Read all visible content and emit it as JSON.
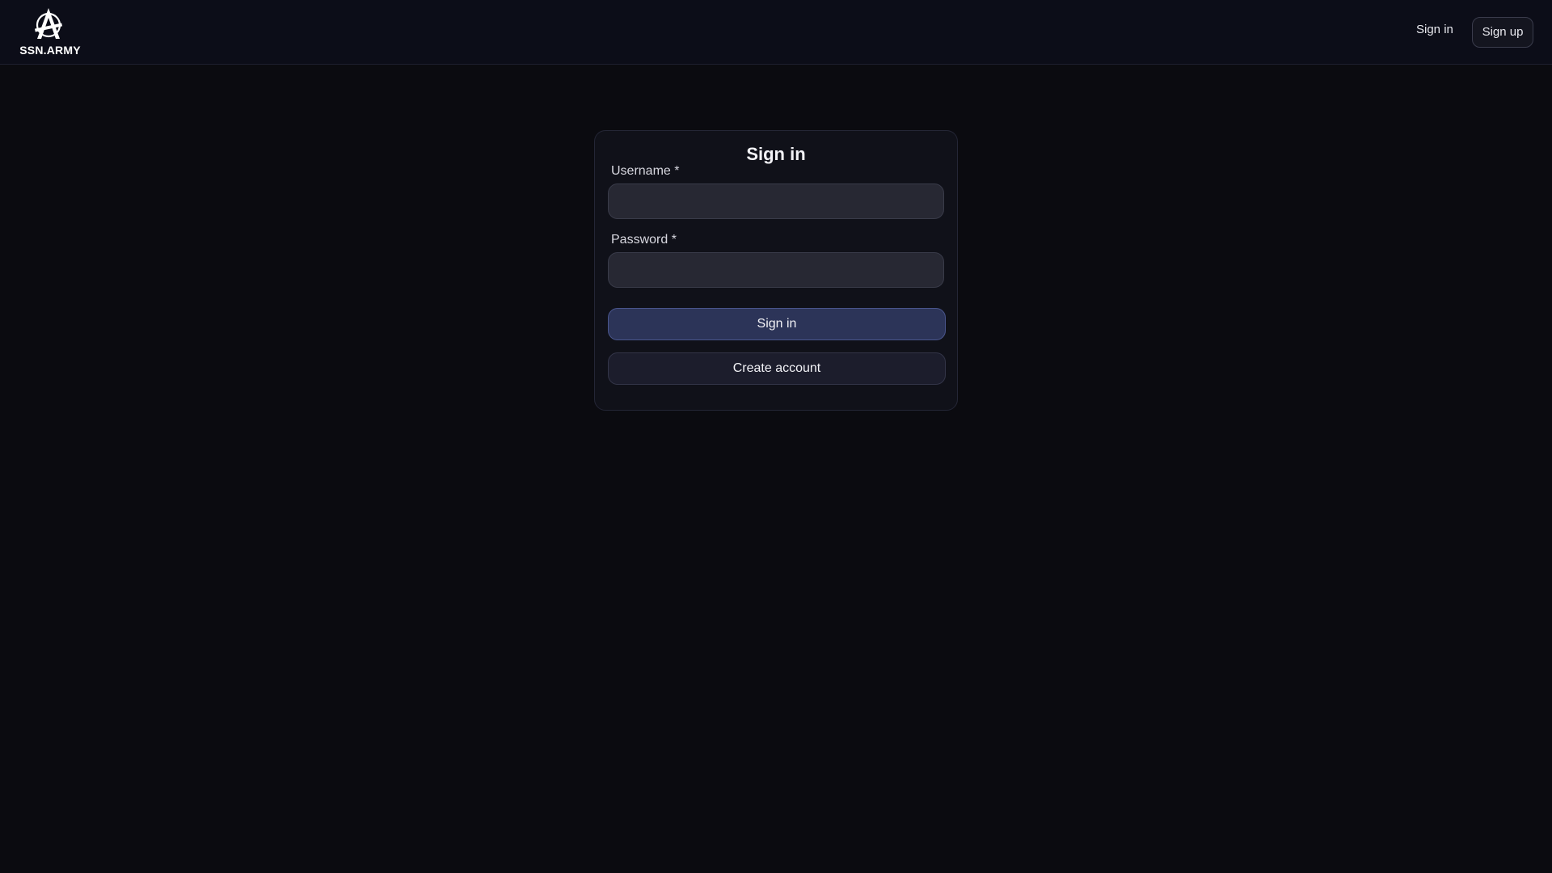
{
  "header": {
    "brand_name": "SSN.ARMY",
    "logo_icon": "anarchy-a-logo-icon",
    "nav": {
      "signin_label": "Sign in",
      "signup_label": "Sign up"
    }
  },
  "login_form": {
    "title": "Sign in",
    "username": {
      "label": "Username *",
      "value": "",
      "placeholder": ""
    },
    "password": {
      "label": "Password *",
      "value": "",
      "placeholder": ""
    },
    "submit_label": "Sign in",
    "create_account_label": "Create account"
  },
  "colors": {
    "page_background": "#0b0b10",
    "header_background": "#0c0d18",
    "card_background": "#101119",
    "input_background": "#272833",
    "primary_button": "#2c3458",
    "secondary_button": "#1c1d2c"
  }
}
